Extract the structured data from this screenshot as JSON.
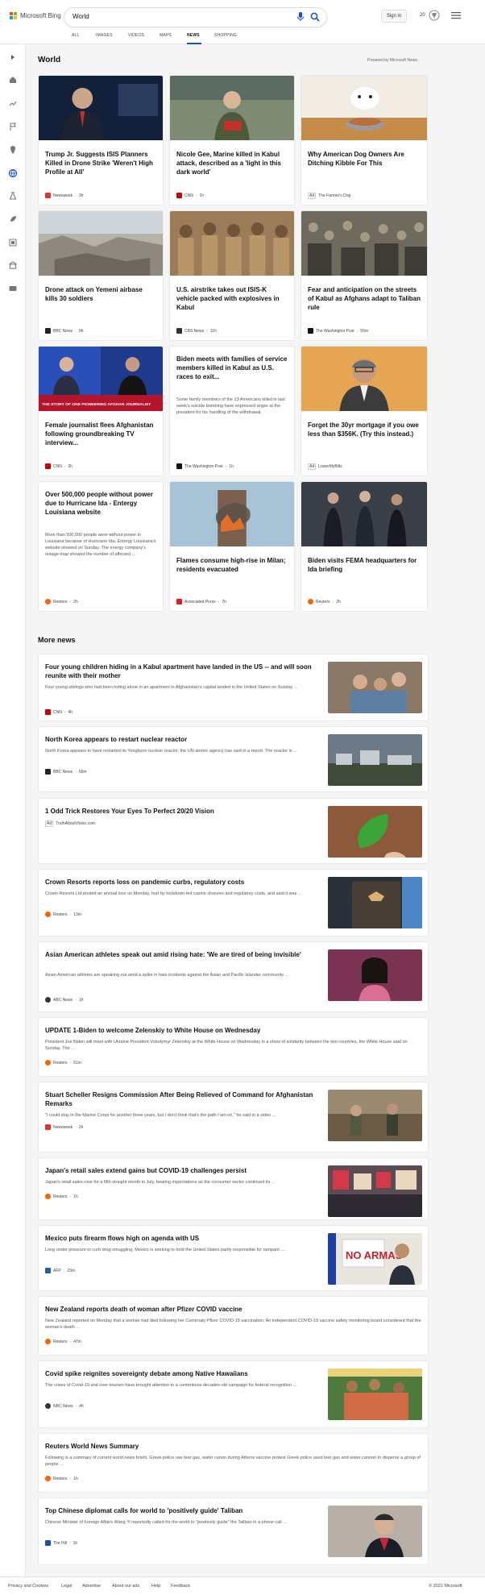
{
  "header": {
    "logo_text": "Microsoft Bing",
    "search_value": "World",
    "signin_label": "Sign in",
    "rewards_count": "20"
  },
  "tabs": [
    "ALL",
    "IMAGES",
    "VIDEOS",
    "MAPS",
    "NEWS",
    "SHOPPING"
  ],
  "section_title": "World",
  "powered_by": "Powered by Microsoft News",
  "cards": [
    {
      "title": "Trump Jr. Suggests ISIS Planners Killed in Drone Strike 'Weren't High Profile at All'",
      "source": "Newsweek",
      "time": "3h",
      "snippet": ""
    },
    {
      "title": "Nicole Gee, Marine killed in Kabul attack, described as a 'light in this dark world'",
      "source": "CNN",
      "time": "1h",
      "snippet": ""
    },
    {
      "title": "Why American Dog Owners Are Ditching Kibble For This",
      "source": "The Farmer's Dog",
      "time": "",
      "ad": "Ad",
      "snippet": ""
    },
    {
      "title": "Drone attack on Yemeni airbase kills 30 soldiers",
      "source": "BBC News",
      "time": "9h",
      "snippet": ""
    },
    {
      "title": "U.S. airstrike takes out ISIS-K vehicle packed with explosives in Kabul",
      "source": "CBS News",
      "time": "11h",
      "snippet": ""
    },
    {
      "title": "Fear and anticipation on the streets of Kabul as Afghans adapt to Taliban rule",
      "source": "The Washington Post",
      "time": "55m",
      "snippet": ""
    },
    {
      "title": "Female journalist flees Afghanistan following groundbreaking TV interview...",
      "source": "CNN",
      "time": "2h",
      "snippet": "",
      "banner": "THE STORY OF ONE PIONEERING AFGHAN JOURNALIST"
    },
    {
      "title": "Biden meets with families of service members killed in Kabul as U.S. races to exit...",
      "source": "The Washington Post",
      "time": "1h",
      "snippet": "Some family members of the 13 Americans killed in last week's suicide bombing have expressed anger at the president for his handling of the withdrawal."
    },
    {
      "title": "Forget the 30yr mortgage if you owe less than $356K. (Try this instead.)",
      "source": "LowerMyBills",
      "time": "",
      "ad": "Ad",
      "snippet": ""
    },
    {
      "title": "Over 500,000 people without power due to Hurricane Ida - Entergy Louisiana website",
      "source": "Reuters",
      "time": "2h",
      "snippet": "More than 500,000 people were without power in Louisiana because of Hurricane Ida, Entergy Louisiana's website showed on Sunday. The energy company's outage map showed the number of affected ..."
    },
    {
      "title": "Flames consume high-rise in Milan; residents evacuated",
      "source": "Associated Press",
      "time": "7h",
      "snippet": ""
    },
    {
      "title": "Biden visits FEMA headquarters for Ida briefing",
      "source": "Reuters",
      "time": "2h",
      "snippet": ""
    }
  ],
  "more_news_title": "More news",
  "more_news": [
    {
      "title": "Four young children hiding in a Kabul apartment have landed in the US -- and will soon reunite with their mother",
      "snippet": "Four young siblings who had been hiding alone in an apartment in Afghanistan's capital landed in the United States on Sunday ...",
      "source": "CNN",
      "time": "4h"
    },
    {
      "title": "North Korea appears to restart nuclear reactor",
      "snippet": "North Korea appears to have restarted its Yongbyon nuclear reactor, the UN atomic agency has said in a report. The reactor is ...",
      "source": "BBC News",
      "time": "56m"
    },
    {
      "title": "1 Odd Trick Restores Your Eyes To Perfect 20/20 Vision",
      "snippet": "",
      "source": "TruthAboutVision.com",
      "time": "",
      "ad": "Ad"
    },
    {
      "title": "Crown Resorts reports loss on pandemic curbs, regulatory costs",
      "snippet": "Crown Resorts Ltd posted an annual loss on Monday, hurt by lockdown-led casino closures and regulatory costs, and said it was ...",
      "source": "Reuters",
      "time": "13m"
    },
    {
      "title": "Asian American athletes speak out amid rising hate: 'We are tired of being invisible'",
      "snippet": "Asian American athletes are speaking out amid a spike in hate incidents against the Asian and Pacific Islander community ...",
      "source": "ABC News",
      "time": "1h"
    },
    {
      "title": "UPDATE 1-Biden to welcome Zelenskiy to White House on Wednesday",
      "snippet": "President Joe Biden will meet with Ukraine President Volodymyr Zelenskiy at the White House on Wednesday in a show of solidarity between the two countries, the White House said on Sunday. The ...",
      "source": "Reuters",
      "time": "51m"
    },
    {
      "title": "Stuart Scheller Resigns Commission After Being Relieved of Command for Afghanistan Remarks",
      "snippet": "\"I could stay in the Marine Corps for another three years, but I don't think that's the path I am on,\" he said in a video ...",
      "source": "Newsweek",
      "time": "2h"
    },
    {
      "title": "Japan's retail sales extend gains but COVID-19 challenges persist",
      "snippet": "Japan's retail sales rose for a fifth straight month in July, beating expectations as the consumer sector continued its ...",
      "source": "Reuters",
      "time": "1h"
    },
    {
      "title": "Mexico puts firearm flows high on agenda with US",
      "snippet": "Long under pressure to curb drug smuggling, Mexico is seeking to hold the United States partly responsible for rampant ...",
      "source": "AFP",
      "time": "23m",
      "thumb_text": "NO ARMAS"
    },
    {
      "title": "New Zealand reports death of woman after Pfizer COVID vaccine",
      "snippet": "New Zealand reported on Monday that a woman had died following her Comirnaty Pfizer COVID-19 vaccination. An independent COVID-19 vaccine safety monitoring board considered that the woman's death ...",
      "source": "Reuters",
      "time": "47m"
    },
    {
      "title": "Covid spike reignites sovereignty debate among Native Hawaiians",
      "snippet": "The crises of Covid-19 and over-tourism have brought attention to a contentious decades-old campaign for federal recognition ...",
      "source": "NBC News",
      "time": "4h"
    },
    {
      "title": "Reuters World News Summary",
      "snippet": "Following is a summary of current world news briefs. Greek police use tear gas, water canon during Athens vaccine protest Greek police used tear gas and water cannon to disperse a group of people ...",
      "source": "Reuters",
      "time": "1h"
    },
    {
      "title": "Top Chinese diplomat calls for world to 'positively guide' Taliban",
      "snippet": "Chinese Minister of Foreign Affairs Wang Yi reportedly called for the world to \"positively guide\" the Taliban in a phone call ...",
      "source": "The Hill",
      "time": "1h"
    }
  ],
  "footer": {
    "links": [
      "Privacy and Cookies",
      "Legal",
      "Advertise",
      "About our ads",
      "Help",
      "Feedback"
    ],
    "copyright": "© 2021 Microsoft"
  },
  "colors": {
    "accent": "#174ae4",
    "brand_red": "#f25022",
    "brand_green": "#7fba00",
    "brand_blue": "#00a4ef",
    "brand_yellow": "#ffb900"
  }
}
